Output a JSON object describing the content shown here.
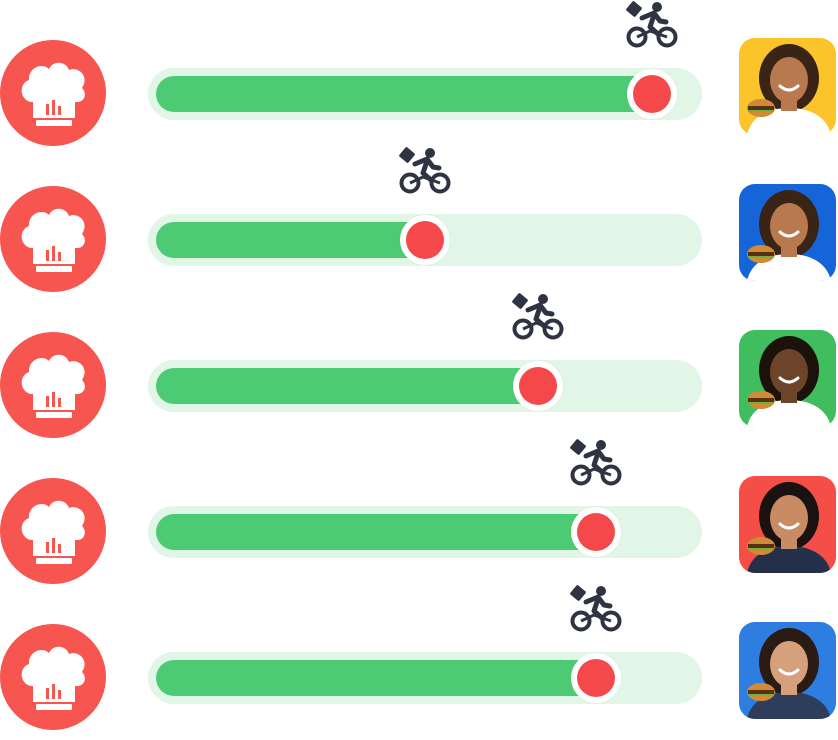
{
  "colors": {
    "chef_badge": "#f75550",
    "track_bg": "#e1f6e6",
    "track_fill": "#4ccb74",
    "knob": "#f4484a",
    "rider": "#2f3442"
  },
  "icons": {
    "chef": "chef-hat-icon",
    "rider": "delivery-bike-icon",
    "avatar": "customer-photo"
  },
  "orders": [
    {
      "progress": 0.95,
      "avatar_bg": "#fbc42b",
      "skin": "#b8794f",
      "hair": "#3a2416",
      "shirt": "#ffffff"
    },
    {
      "progress": 0.5,
      "avatar_bg": "#1565d8",
      "skin": "#b8794f",
      "hair": "#3a2416",
      "shirt": "#ffffff"
    },
    {
      "progress": 0.725,
      "avatar_bg": "#3fbd5f",
      "skin": "#6b4429",
      "hair": "#1b120c",
      "shirt": "#ffffff"
    },
    {
      "progress": 0.84,
      "avatar_bg": "#f44e47",
      "skin": "#c98b63",
      "hair": "#1a1210",
      "shirt": "#24304a"
    },
    {
      "progress": 0.84,
      "avatar_bg": "#2e7de0",
      "skin": "#d6a07c",
      "hair": "#2a1c14",
      "shirt": "#2f3d5c"
    }
  ]
}
